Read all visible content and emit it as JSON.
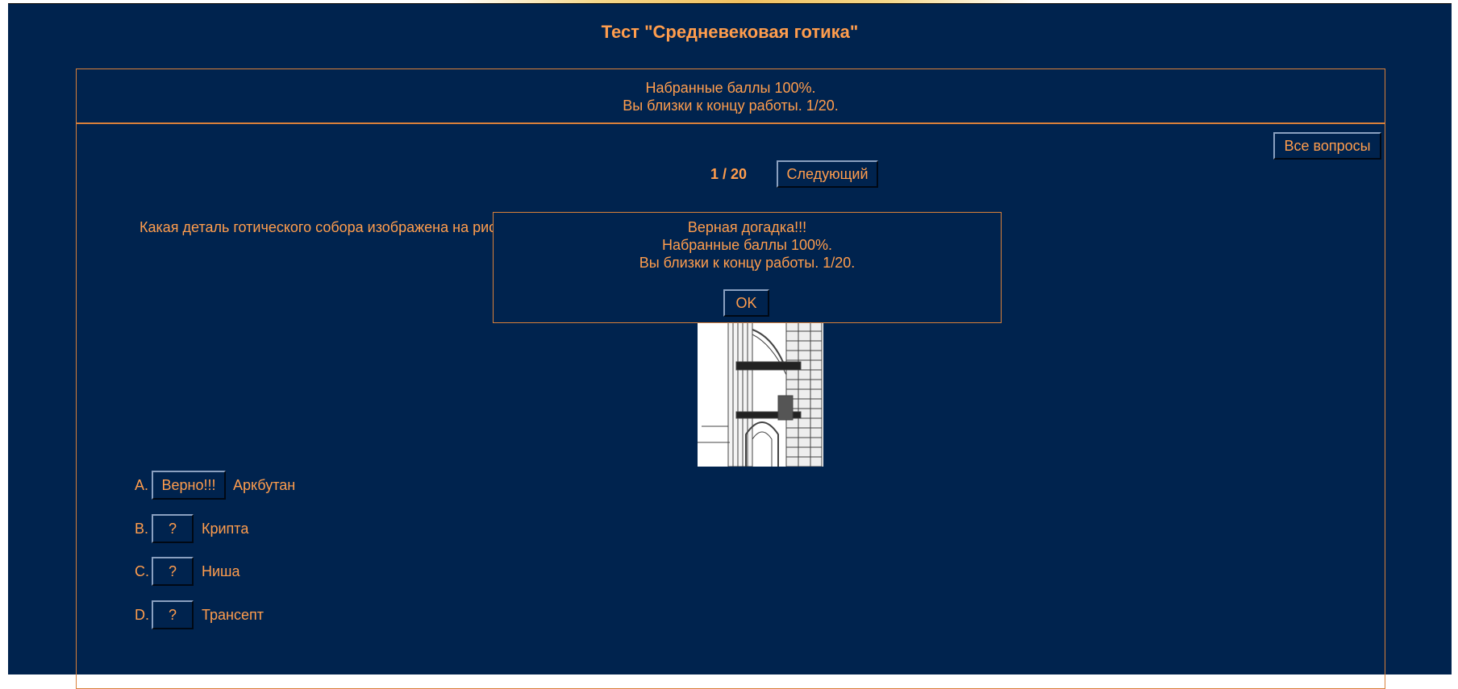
{
  "title": "Тест \"Средневековая готика\"",
  "status": {
    "line1": "Набранные баллы 100%.",
    "line2": "Вы близки к концу работы. 1/20."
  },
  "toolbar": {
    "all_questions_label": "Все вопросы",
    "counter": "1 / 20",
    "next_label": "Следующий"
  },
  "question": {
    "text": "Какая деталь готического собора изображена на рисунке?"
  },
  "options": [
    {
      "letter": "A.",
      "button": "Верно!!!",
      "text": "Аркбутан"
    },
    {
      "letter": "B.",
      "button": "?",
      "text": "Крипта"
    },
    {
      "letter": "C.",
      "button": "?",
      "text": "Ниша"
    },
    {
      "letter": "D.",
      "button": "?",
      "text": "Трансепт"
    }
  ],
  "dialog": {
    "line1": "Верная догадка!!!",
    "line2": "Набранные баллы 100%.",
    "line3": "Вы близки к концу работы. 1/20.",
    "ok_label": "OK"
  },
  "colors": {
    "background": "#00234e",
    "accent": "#ff9d4d",
    "border": "#d9803a"
  }
}
